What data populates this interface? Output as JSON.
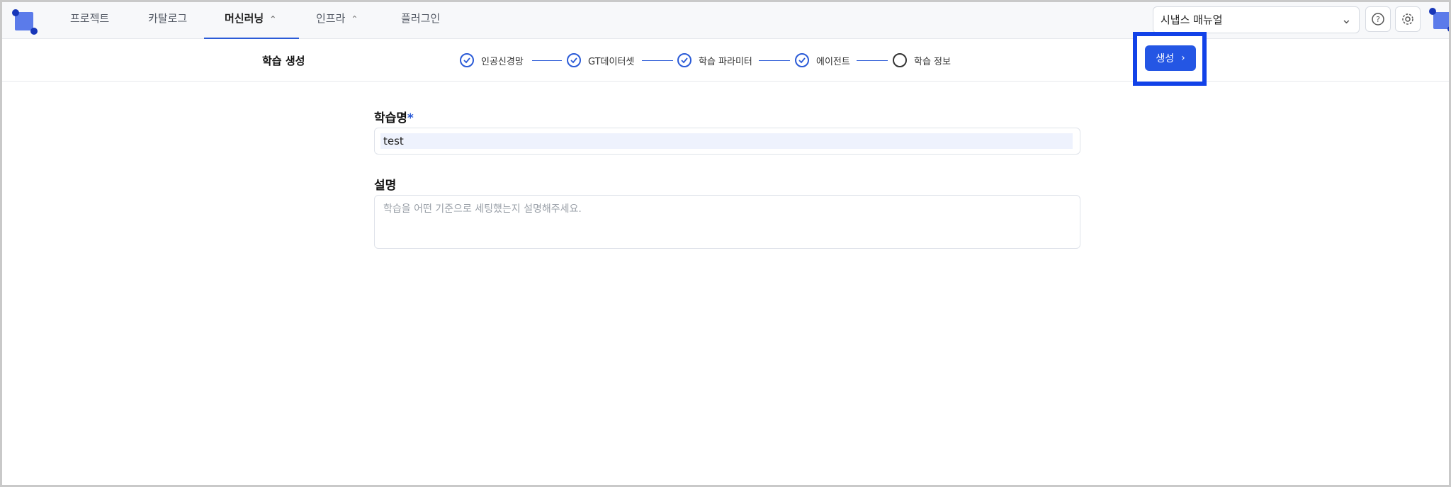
{
  "nav": {
    "items": [
      {
        "label": "프로젝트"
      },
      {
        "label": "카탈로그"
      },
      {
        "label": "머신러닝",
        "expandable": true,
        "active": true
      },
      {
        "label": "인프라",
        "expandable": true
      },
      {
        "label": "플러그인"
      }
    ],
    "manual_select": {
      "value": "시냅스 매뉴얼",
      "icon": "chevron-down-icon"
    },
    "icons": [
      "help-icon",
      "settings-icon",
      "logo-icon"
    ]
  },
  "subheader": {
    "title": "학습 생성",
    "steps": [
      {
        "label": "인공신경망",
        "done": true
      },
      {
        "label": "GT데이터셋",
        "done": true
      },
      {
        "label": "학습 파라미터",
        "done": true
      },
      {
        "label": "에이전트",
        "done": true
      },
      {
        "label": "학습 정보",
        "done": false
      }
    ],
    "create_button": {
      "label": "생성",
      "icon": "chevron-right-icon"
    }
  },
  "form": {
    "name_label": "학습명",
    "required_mark": "*",
    "name_value": "test",
    "desc_label": "설명",
    "desc_placeholder": "학습을 어떤 기준으로 세팅했는지 설명해주세요."
  },
  "colors": {
    "accent": "#2456e4",
    "highlight": "#1242e8"
  }
}
